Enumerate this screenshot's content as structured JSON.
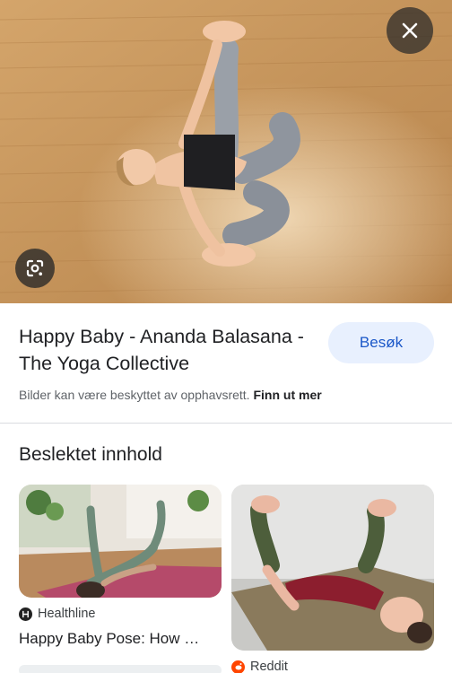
{
  "hero": {
    "image_alt": "Woman lying on wooden floor in Happy Baby yoga pose",
    "close_icon": "close-icon",
    "lens_icon": "google-lens-icon"
  },
  "result": {
    "title": "Happy Baby - Ananda Balasana - The Yoga Collective",
    "visit_label": "Besøk"
  },
  "copyright": {
    "text": "Bilder kan være beskyttet av opphavsrett.",
    "learn_more": "Finn ut mer"
  },
  "related": {
    "heading": "Beslektet innhold",
    "items": [
      {
        "source": "Healthline",
        "title": "Happy Baby Pose: How …",
        "source_icon": "healthline-icon"
      },
      {
        "source": "Reddit",
        "title": "",
        "source_icon": "reddit-icon"
      }
    ]
  },
  "colors": {
    "accent": "#1a57c8",
    "button_bg": "#e8f0fe",
    "floor": "#c89a62"
  }
}
